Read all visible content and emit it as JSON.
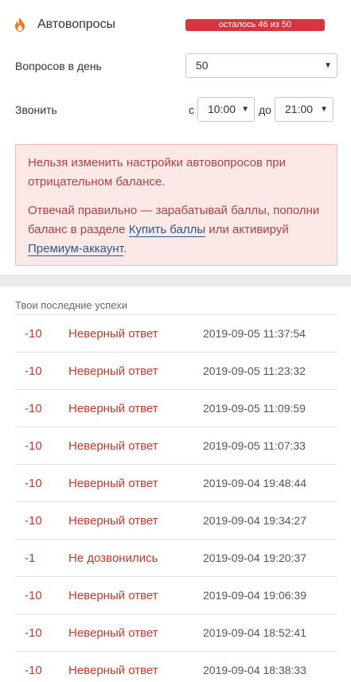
{
  "header": {
    "icon": "flame-icon",
    "title": "Автовопросы",
    "quota_label": "осталось 46 из 50",
    "quota_color": "#d9333f"
  },
  "settings": {
    "per_day_label": "Вопросов в день",
    "per_day_value": "50",
    "call_label": "Звонить",
    "from_label": "с",
    "from_value": "10:00",
    "to_label": "до",
    "to_value": "21:00"
  },
  "alert": {
    "line1": "Нельзя изменить настройки автовопросов при отрицательном балансе.",
    "part1": "Отвечай правильно — зарабатывай баллы, пополни баланс в разделе ",
    "link1": "Купить баллы",
    "part2": " или активируй ",
    "link2": "Премиум-аккаунт",
    "part3": "."
  },
  "history": {
    "title": "Твои последние успехи",
    "items": [
      {
        "points": "-10",
        "status": "Неверный ответ",
        "time": "2019-09-05 11:37:54"
      },
      {
        "points": "-10",
        "status": "Неверный ответ",
        "time": "2019-09-05 11:23:32"
      },
      {
        "points": "-10",
        "status": "Неверный ответ",
        "time": "2019-09-05 11:09:59"
      },
      {
        "points": "-10",
        "status": "Неверный ответ",
        "time": "2019-09-05 11:07:33"
      },
      {
        "points": "-10",
        "status": "Неверный ответ",
        "time": "2019-09-04 19:48:44"
      },
      {
        "points": "-10",
        "status": "Неверный ответ",
        "time": "2019-09-04 19:34:27"
      },
      {
        "points": "-1",
        "status": "Не дозвонились",
        "time": "2019-09-04 19:20:37"
      },
      {
        "points": "-10",
        "status": "Неверный ответ",
        "time": "2019-09-04 19:06:39"
      },
      {
        "points": "-10",
        "status": "Неверный ответ",
        "time": "2019-09-04 18:52:41"
      },
      {
        "points": "-10",
        "status": "Неверный ответ",
        "time": "2019-09-04 18:38:33"
      }
    ]
  }
}
